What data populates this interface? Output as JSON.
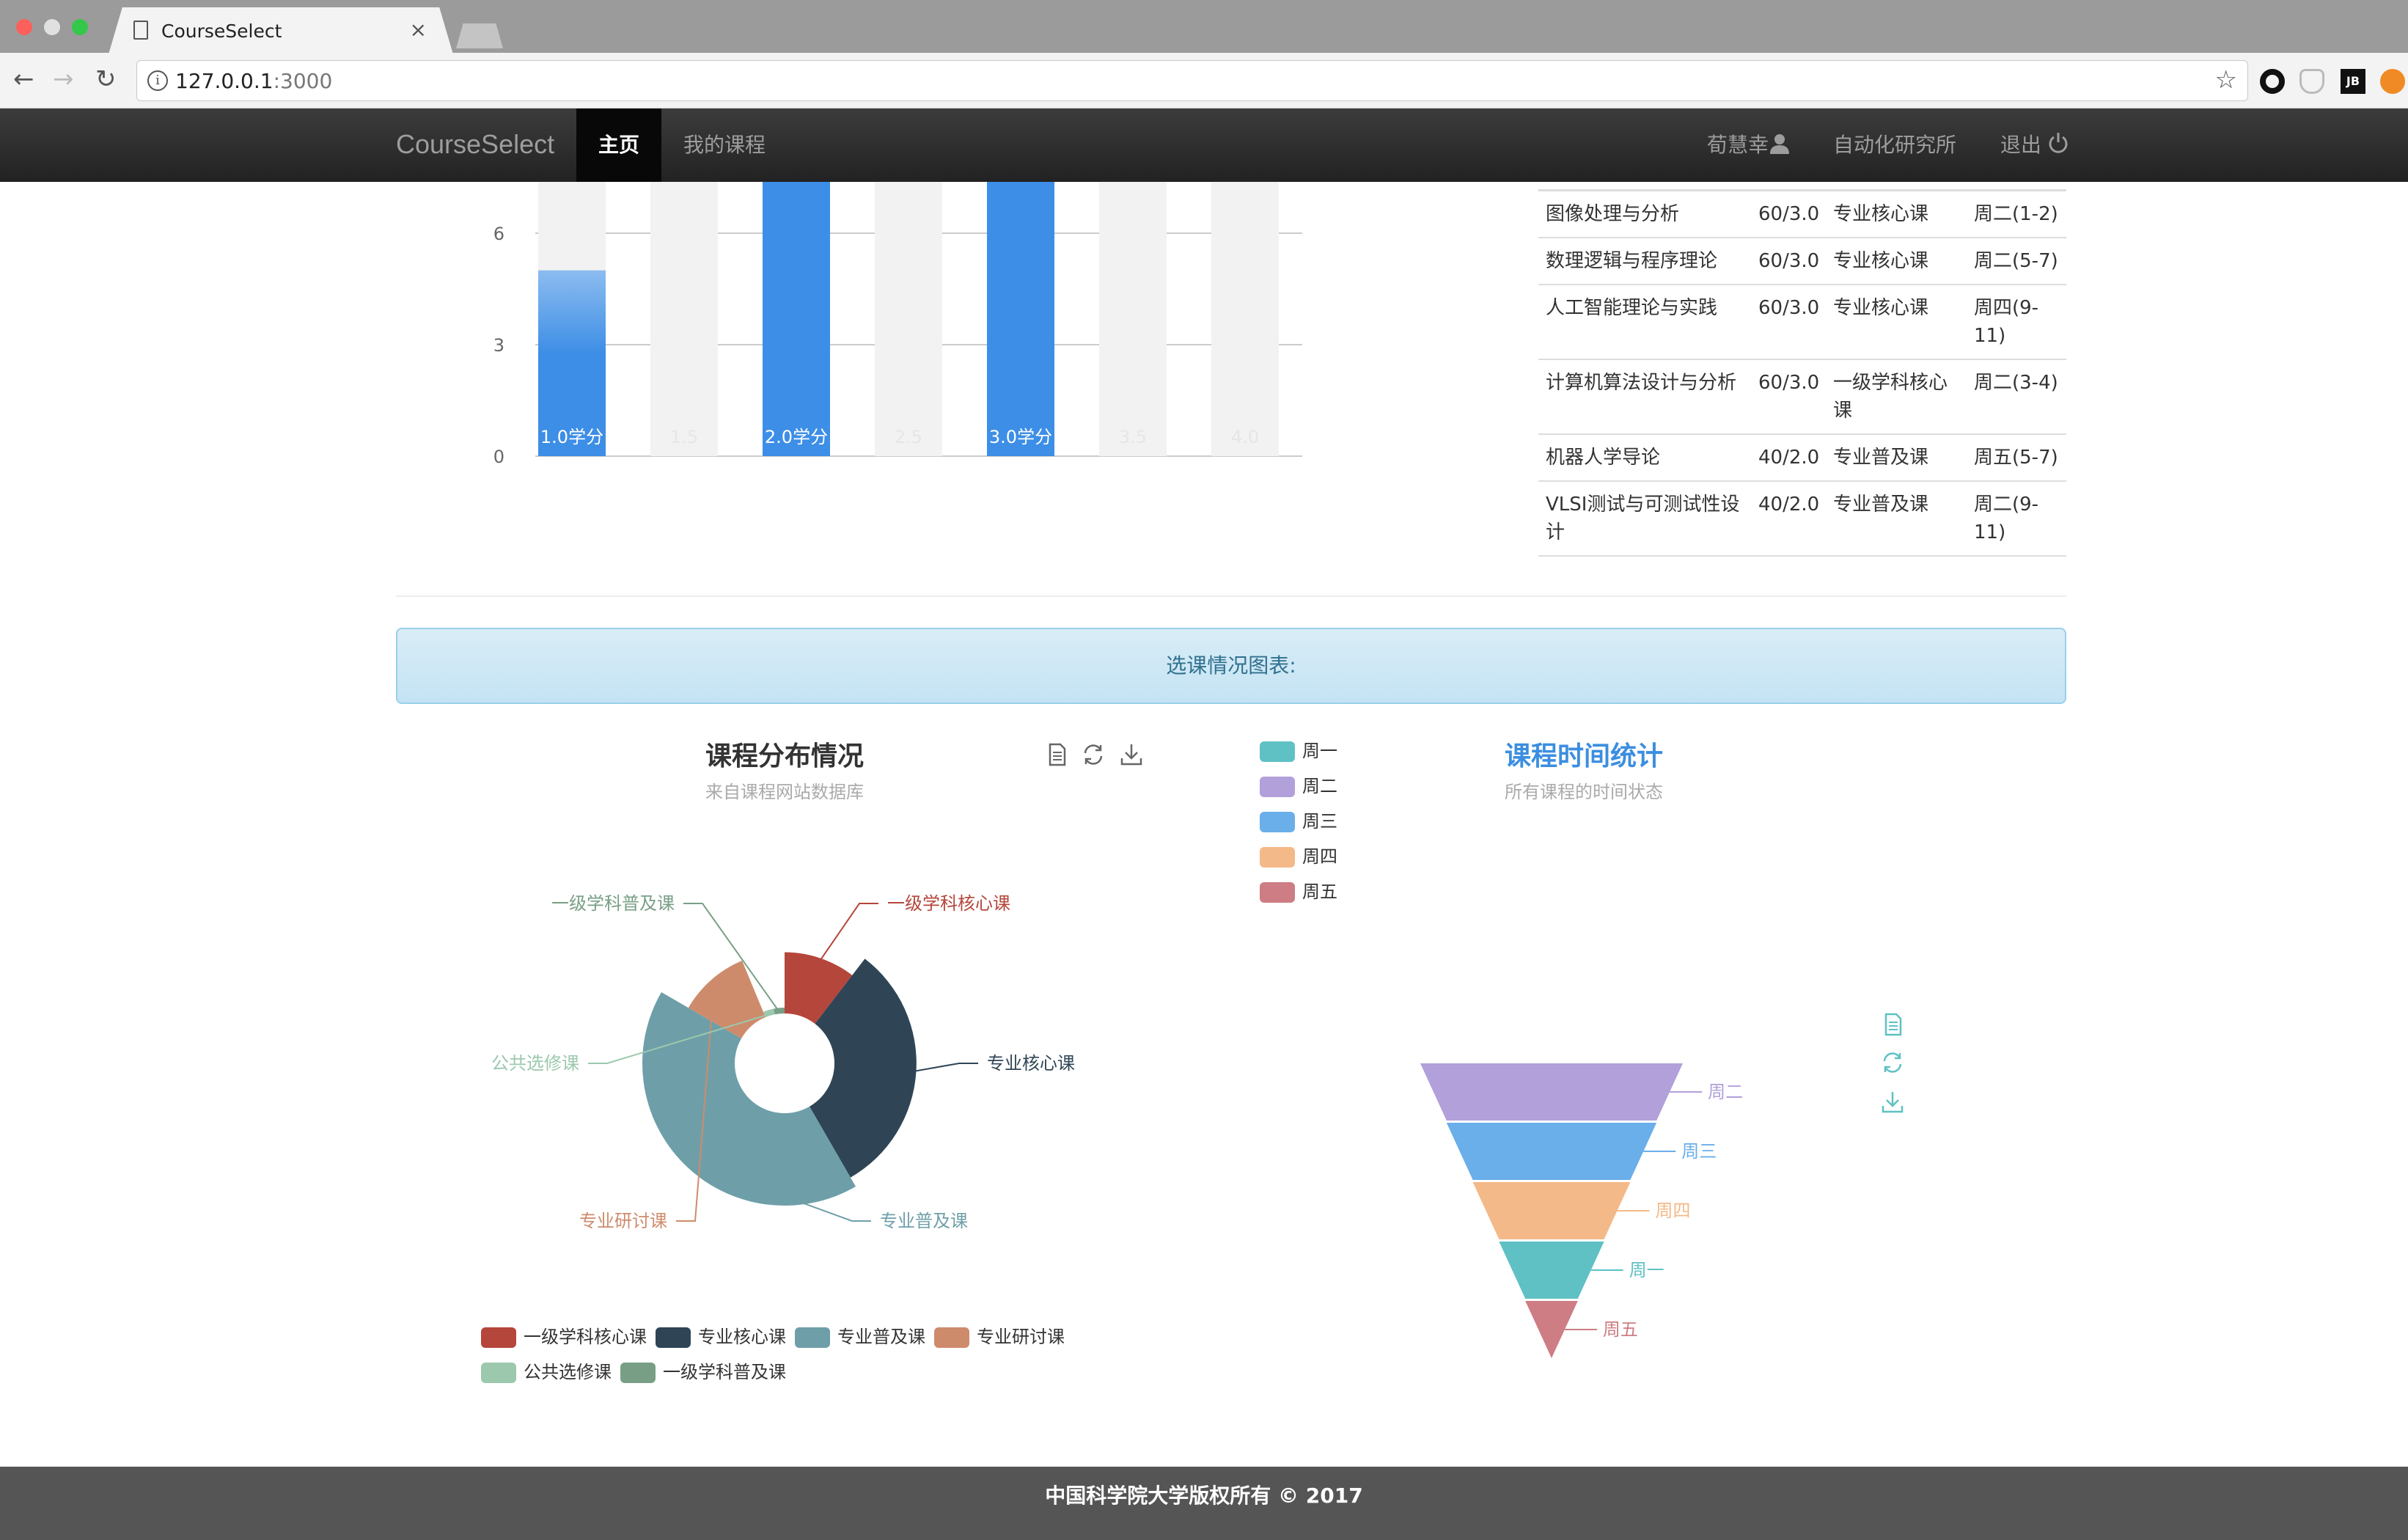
{
  "browser": {
    "tab_title": "CourseSelect",
    "tab_close": "×",
    "url_host": "127.0.0.1",
    "url_port": ":3000"
  },
  "nav": {
    "brand": "CourseSelect",
    "home": "主页",
    "my_courses": "我的课程",
    "user": "荀慧幸",
    "institute": "自动化研究所",
    "logout": "退出"
  },
  "colors": {
    "bar_active": "#3d8ee6",
    "bar_background": "#f2f2f2",
    "panel_text": "#31708f",
    "funnel_title": "#3c8ee0"
  },
  "bar_chart_data": {
    "type": "bar",
    "categories": [
      "1.0学分",
      "1.5",
      "2.0学分",
      "2.5",
      "3.0学分",
      "3.5",
      "4.0"
    ],
    "values": [
      5,
      0,
      8,
      0,
      8,
      0,
      0
    ],
    "yticks": [
      "0",
      "3",
      "6"
    ],
    "ylim": [
      0,
      7.5
    ]
  },
  "course_table": {
    "rows": [
      [
        "图像处理与分析",
        "60/3.0",
        "专业核心课",
        "周二(1-2)"
      ],
      [
        "数理逻辑与程序理论",
        "60/3.0",
        "专业核心课",
        "周二(5-7)"
      ],
      [
        "人工智能理论与实践",
        "60/3.0",
        "专业核心课",
        "周四(9-11)"
      ],
      [
        "计算机算法设计与分析",
        "60/3.0",
        "一级学科核心课",
        "周二(3-4)"
      ],
      [
        "机器人学导论",
        "40/2.0",
        "专业普及课",
        "周五(5-7)"
      ],
      [
        "VLSI测试与可测试性设计",
        "40/2.0",
        "专业普及课",
        "周二(9-11)"
      ]
    ]
  },
  "panel_heading": "选课情况图表:",
  "pie": {
    "title": "课程分布情况",
    "subtitle": "来自课程网站数据库"
  },
  "funnel": {
    "title": "课程时间统计",
    "subtitle": "所有课程的时间状态"
  },
  "chart_data": [
    {
      "type": "pie",
      "rose": true,
      "title": "课程分布情况",
      "subtitle": "来自课程网站数据库",
      "slices": [
        {
          "name": "一级学科核心课",
          "value": 1,
          "color": "#b5463b"
        },
        {
          "name": "专业核心课",
          "value": 3,
          "color": "#2f4556"
        },
        {
          "name": "专业普及课",
          "value": 4,
          "color": "#6e9fa9"
        },
        {
          "name": "专业研讨课",
          "value": 1,
          "color": "#ce8b6c"
        },
        {
          "name": "公共选修课",
          "value": 0.3,
          "color": "#9cc8ad"
        },
        {
          "name": "一级学科普及课",
          "value": 0.3,
          "color": "#789f85"
        }
      ]
    },
    {
      "type": "funnel",
      "title": "课程时间统计",
      "subtitle": "所有课程的时间状态",
      "legend": [
        {
          "name": "周一",
          "color": "#5fc1c4"
        },
        {
          "name": "周二",
          "color": "#b1a0d9"
        },
        {
          "name": "周三",
          "color": "#6aaeea"
        },
        {
          "name": "周四",
          "color": "#f4b988"
        },
        {
          "name": "周五",
          "color": "#cd7d83"
        }
      ],
      "stages": [
        {
          "name": "周二",
          "value": 5
        },
        {
          "name": "周三",
          "value": 4
        },
        {
          "name": "周四",
          "value": 3
        },
        {
          "name": "周一",
          "value": 2
        },
        {
          "name": "周五",
          "value": 1
        }
      ]
    }
  ],
  "footer": "中国科学院大学版权所有 © 2017"
}
